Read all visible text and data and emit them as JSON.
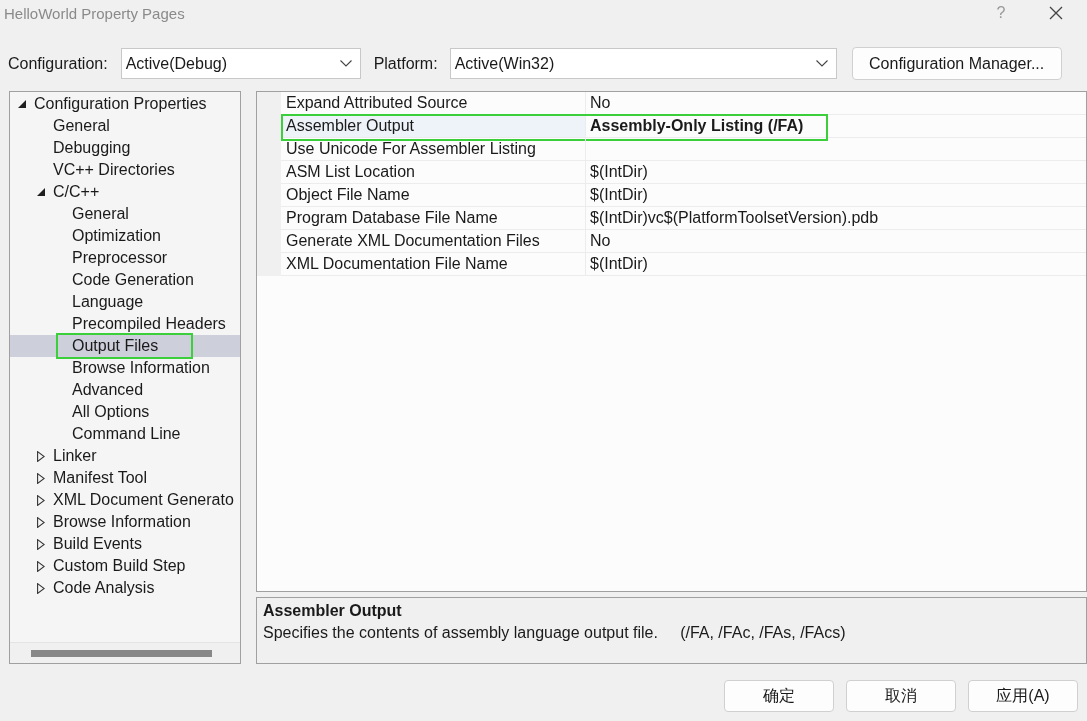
{
  "window": {
    "title": "HelloWorld Property Pages",
    "help_button": "?"
  },
  "toolbar": {
    "configuration": {
      "label": "Configuration:",
      "value": "Active(Debug)"
    },
    "platform": {
      "label": "Platform:",
      "value": "Active(Win32)"
    },
    "manager_button": "Configuration Manager..."
  },
  "tree": {
    "items": [
      {
        "label": "Configuration Properties",
        "expanded": true,
        "selected": false,
        "highlighted": false,
        "children": [
          {
            "label": "General",
            "selected": false,
            "highlighted": false
          },
          {
            "label": "Debugging",
            "selected": false,
            "highlighted": false
          },
          {
            "label": "VC++ Directories",
            "selected": false,
            "highlighted": false
          },
          {
            "label": "C/C++",
            "expanded": true,
            "selected": false,
            "highlighted": false,
            "children": [
              {
                "label": "General",
                "selected": false,
                "highlighted": false
              },
              {
                "label": "Optimization",
                "selected": false,
                "highlighted": false
              },
              {
                "label": "Preprocessor",
                "selected": false,
                "highlighted": false
              },
              {
                "label": "Code Generation",
                "selected": false,
                "highlighted": false
              },
              {
                "label": "Language",
                "selected": false,
                "highlighted": false
              },
              {
                "label": "Precompiled Headers",
                "selected": false,
                "highlighted": false
              },
              {
                "label": "Output Files",
                "selected": true,
                "highlighted": true
              },
              {
                "label": "Browse Information",
                "selected": false,
                "highlighted": false
              },
              {
                "label": "Advanced",
                "selected": false,
                "highlighted": false
              },
              {
                "label": "All Options",
                "selected": false,
                "highlighted": false
              },
              {
                "label": "Command Line",
                "selected": false,
                "highlighted": false
              }
            ]
          },
          {
            "label": "Linker",
            "expanded": false,
            "selected": false,
            "highlighted": false
          },
          {
            "label": "Manifest Tool",
            "expanded": false,
            "selected": false,
            "highlighted": false
          },
          {
            "label": "XML Document Generato",
            "expanded": false,
            "selected": false,
            "highlighted": false
          },
          {
            "label": "Browse Information",
            "expanded": false,
            "selected": false,
            "highlighted": false
          },
          {
            "label": "Build Events",
            "expanded": false,
            "selected": false,
            "highlighted": false
          },
          {
            "label": "Custom Build Step",
            "expanded": false,
            "selected": false,
            "highlighted": false
          },
          {
            "label": "Code Analysis",
            "expanded": false,
            "selected": false,
            "highlighted": false
          }
        ]
      }
    ]
  },
  "grid": {
    "rows": [
      {
        "name": "Expand Attributed Source",
        "value": "No",
        "modified": false,
        "selected": false,
        "highlighted": false
      },
      {
        "name": "Assembler Output",
        "value": "Assembly-Only Listing (/FA)",
        "modified": true,
        "selected": true,
        "highlighted": true
      },
      {
        "name": "Use Unicode For Assembler Listing",
        "selected": false,
        "highlighted": false
      },
      {
        "name": "ASM List Location",
        "value": "$(IntDir)",
        "modified": false,
        "selected": false,
        "highlighted": false
      },
      {
        "name": "Object File Name",
        "value": "$(IntDir)",
        "modified": false,
        "selected": false,
        "highlighted": false
      },
      {
        "name": "Program Database File Name",
        "value": "$(IntDir)vc$(PlatformToolsetVersion).pdb",
        "modified": false,
        "selected": false,
        "highlighted": false
      },
      {
        "name": "Generate XML Documentation Files",
        "value": "No",
        "modified": false,
        "selected": false,
        "highlighted": false
      },
      {
        "name": "XML Documentation File Name",
        "value": "$(IntDir)",
        "modified": false,
        "selected": false,
        "highlighted": false
      }
    ]
  },
  "description": {
    "title": "Assembler Output",
    "text": "Specifies the contents of assembly language output file.     (/FA, /FAc, /FAs, /FAcs)"
  },
  "buttons": [
    "确定",
    "取消",
    "应用(A)"
  ]
}
